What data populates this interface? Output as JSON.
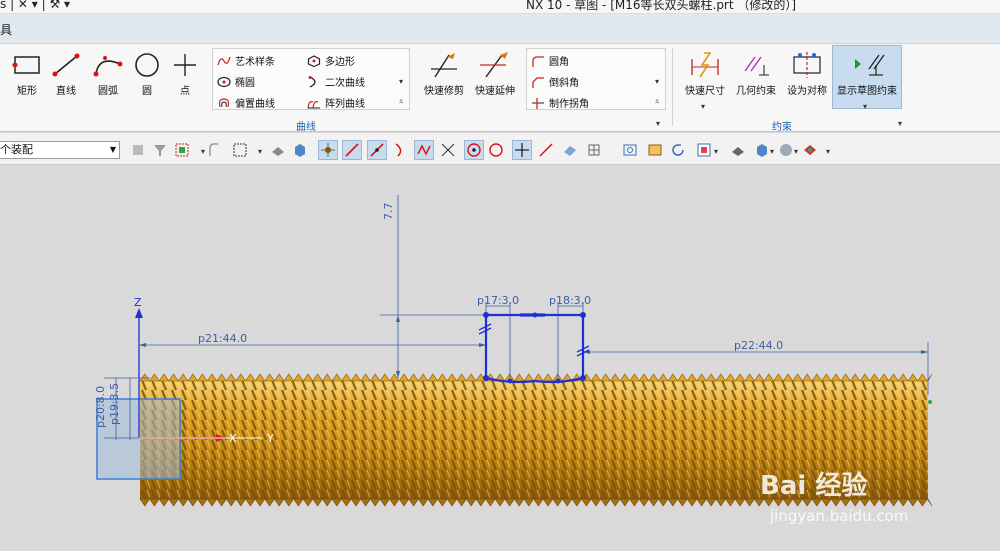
{
  "window": {
    "title": "NX 10 - 草图 - [M16等长双头螺柱.prt （修改的）]",
    "quick_access": "s | ✕ ▾ | ⚒ ▾"
  },
  "menu": {
    "tool_label": "具"
  },
  "ribbon": {
    "big_buttons": [
      {
        "label": "矩形",
        "icon": "rectangle-icon"
      },
      {
        "label": "直线",
        "icon": "line-icon"
      },
      {
        "label": "圆弧",
        "icon": "arc-icon"
      },
      {
        "label": "圆",
        "icon": "circle-icon"
      },
      {
        "label": "点",
        "icon": "point-icon"
      }
    ],
    "curve_panel": {
      "col1": [
        "艺术样条",
        "椭圆",
        "偏置曲线"
      ],
      "col2": [
        "多边形",
        "二次曲线",
        "阵列曲线"
      ]
    },
    "mid_buttons": [
      {
        "label": "快速修剪",
        "icon": "quick-trim-icon"
      },
      {
        "label": "快速延伸",
        "icon": "quick-extend-icon"
      }
    ],
    "corner_panel": [
      "圆角",
      "倒斜角",
      "制作拐角"
    ],
    "constraint_buttons": [
      {
        "label": "快速尺寸",
        "icon": "rapid-dimension-icon"
      },
      {
        "label": "几何约束",
        "icon": "geometric-constraint-icon"
      },
      {
        "label": "设为对称",
        "icon": "make-symmetric-icon"
      },
      {
        "label": "显示草图约束",
        "icon": "show-constraints-icon"
      }
    ],
    "groups": {
      "curve": "曲线",
      "constraint": "约束"
    }
  },
  "toolbar": {
    "assembly_select": "个装配"
  },
  "sketch": {
    "dims": {
      "p21": "p21:44.0",
      "p22": "p22:44.0",
      "p17": "p17:3.0",
      "p18": "p18:3.0",
      "v77": "7.7",
      "left1": "p20:8.0",
      "left2": "p19:3.5"
    },
    "axes": {
      "z": "Z",
      "x": "X",
      "y": "Y"
    }
  },
  "watermark": {
    "line1": "Bai 经验",
    "line2": "jingyan.baidu.com"
  },
  "colors": {
    "thread_fill": "#e2a52a",
    "thread_dark": "#7a5206",
    "dimension_blue": "#3d5fa8",
    "sketch_blue": "#1f2fd6",
    "ribbon_blue_text": "#1a5fa8"
  }
}
